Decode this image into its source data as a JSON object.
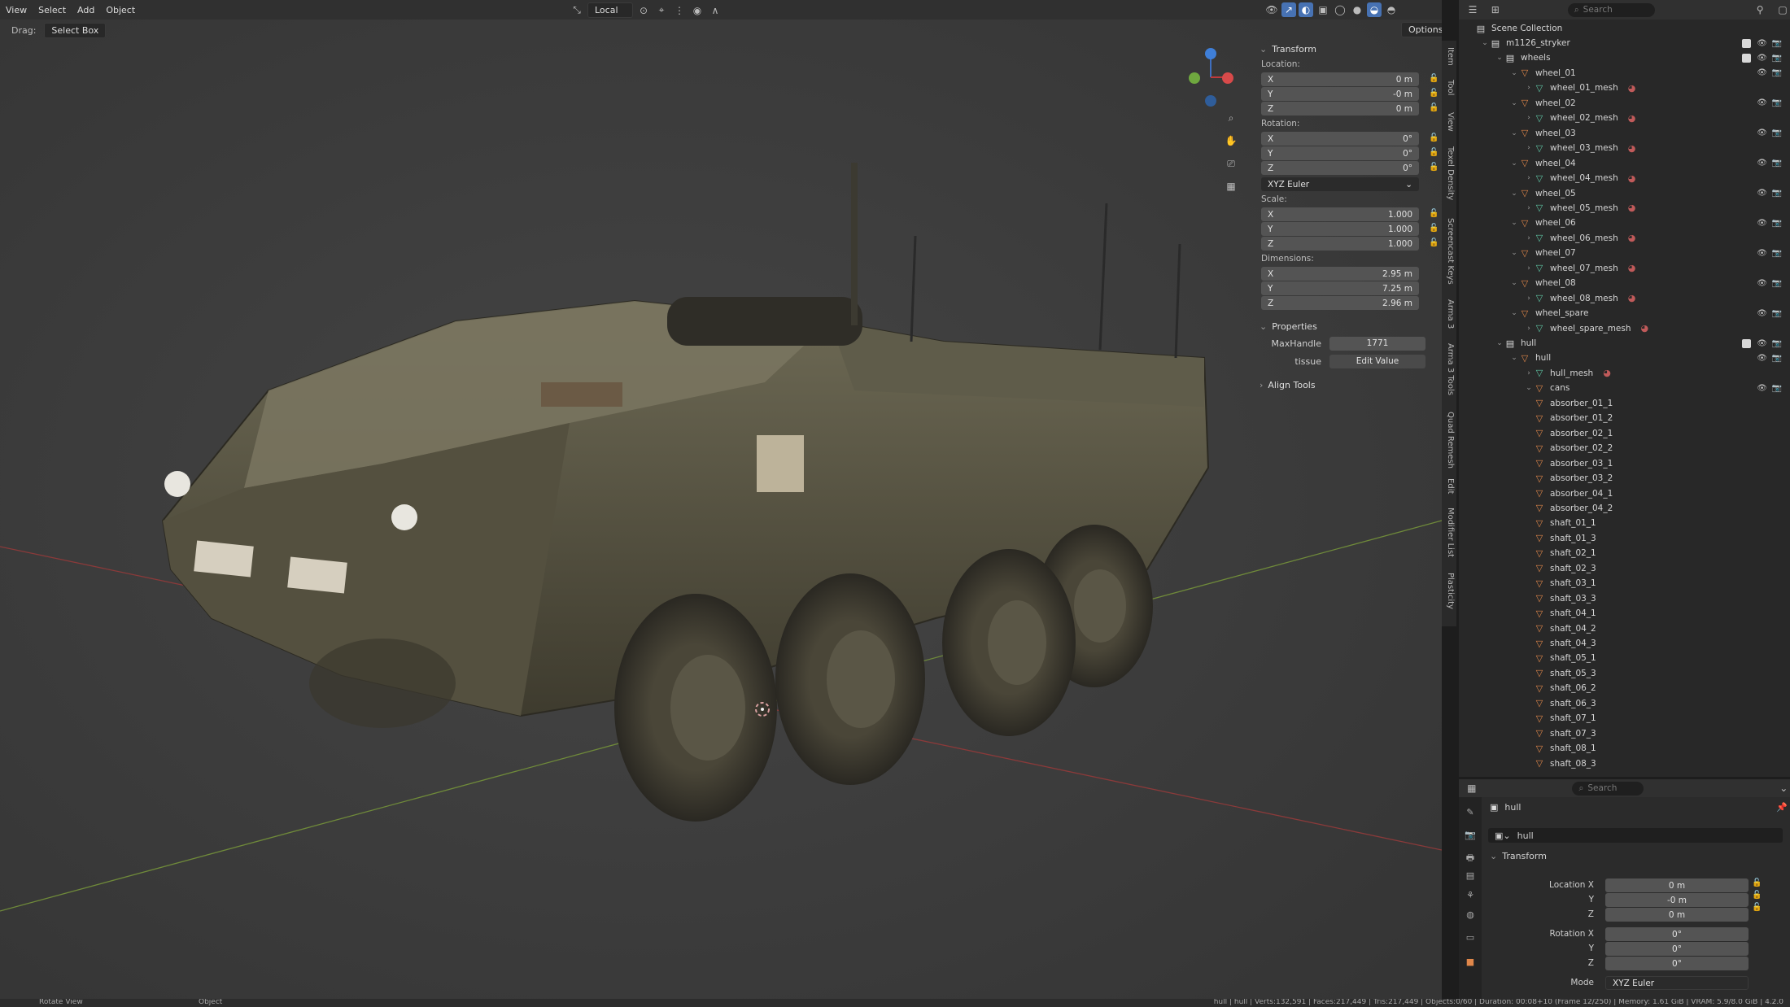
{
  "header": {
    "menus": [
      "View",
      "Select",
      "Add",
      "Object"
    ],
    "orientation": "Local",
    "options": "Options",
    "drag_label": "Drag:",
    "drag_value": "Select Box"
  },
  "npanel": {
    "transform_title": "Transform",
    "location_label": "Location:",
    "location": {
      "x": "0 m",
      "y": "-0 m",
      "z": "0 m"
    },
    "rotation_label": "Rotation:",
    "rotation": {
      "x": "0°",
      "y": "0°",
      "z": "0°"
    },
    "rotation_mode": "XYZ Euler",
    "scale_label": "Scale:",
    "scale": {
      "x": "1.000",
      "y": "1.000",
      "z": "1.000"
    },
    "dimensions_label": "Dimensions:",
    "dimensions": {
      "x": "2.95 m",
      "y": "7.25 m",
      "z": "2.96 m"
    },
    "axis": {
      "x": "X",
      "y": "Y",
      "z": "Z"
    },
    "properties_title": "Properties",
    "maxhandle_label": "MaxHandle",
    "maxhandle_value": "1771",
    "tissue_label": "tissue",
    "tissue_value": "Edit Value",
    "align_title": "Align Tools"
  },
  "side_tabs": [
    "Item",
    "Tool",
    "View",
    "Texel Density",
    "Screencast Keys",
    "Arma 3",
    "Arma 3 Tools",
    "Quad Remesh",
    "Edit",
    "Modifier List",
    "Plasticity"
  ],
  "outliner": {
    "search_placeholder": "Search",
    "scene_collection": "Scene Collection",
    "rows": [
      {
        "label": "m1126_stryker",
        "type": "collection",
        "indent": 1
      },
      {
        "label": "wheels",
        "type": "collection",
        "indent": 2
      },
      {
        "label": "wheel_01",
        "type": "empty",
        "indent": 3
      },
      {
        "label": "wheel_01_mesh",
        "type": "mesh",
        "indent": 4
      },
      {
        "label": "wheel_02",
        "type": "empty",
        "indent": 3
      },
      {
        "label": "wheel_02_mesh",
        "type": "mesh",
        "indent": 4
      },
      {
        "label": "wheel_03",
        "type": "empty",
        "indent": 3
      },
      {
        "label": "wheel_03_mesh",
        "type": "mesh",
        "indent": 4
      },
      {
        "label": "wheel_04",
        "type": "empty",
        "indent": 3
      },
      {
        "label": "wheel_04_mesh",
        "type": "mesh",
        "indent": 4
      },
      {
        "label": "wheel_05",
        "type": "empty",
        "indent": 3
      },
      {
        "label": "wheel_05_mesh",
        "type": "mesh",
        "indent": 4
      },
      {
        "label": "wheel_06",
        "type": "empty",
        "indent": 3
      },
      {
        "label": "wheel_06_mesh",
        "type": "mesh",
        "indent": 4
      },
      {
        "label": "wheel_07",
        "type": "empty",
        "indent": 3
      },
      {
        "label": "wheel_07_mesh",
        "type": "mesh",
        "indent": 4
      },
      {
        "label": "wheel_08",
        "type": "empty",
        "indent": 3
      },
      {
        "label": "wheel_08_mesh",
        "type": "mesh",
        "indent": 4
      },
      {
        "label": "wheel_spare",
        "type": "empty",
        "indent": 3
      },
      {
        "label": "wheel_spare_mesh",
        "type": "mesh",
        "indent": 4
      },
      {
        "label": "hull",
        "type": "collection",
        "indent": 2
      },
      {
        "label": "hull",
        "type": "empty",
        "indent": 3
      },
      {
        "label": "hull_mesh",
        "type": "mesh",
        "indent": 4
      },
      {
        "label": "cans",
        "type": "empty",
        "indent": 4
      },
      {
        "label": "absorber_01_1",
        "type": "empty",
        "indent": 4
      },
      {
        "label": "absorber_01_2",
        "type": "empty",
        "indent": 4
      },
      {
        "label": "absorber_02_1",
        "type": "empty",
        "indent": 4
      },
      {
        "label": "absorber_02_2",
        "type": "empty",
        "indent": 4
      },
      {
        "label": "absorber_03_1",
        "type": "empty",
        "indent": 4
      },
      {
        "label": "absorber_03_2",
        "type": "empty",
        "indent": 4
      },
      {
        "label": "absorber_04_1",
        "type": "empty",
        "indent": 4
      },
      {
        "label": "absorber_04_2",
        "type": "empty",
        "indent": 4
      },
      {
        "label": "shaft_01_1",
        "type": "empty",
        "indent": 4
      },
      {
        "label": "shaft_01_3",
        "type": "empty",
        "indent": 4
      },
      {
        "label": "shaft_02_1",
        "type": "empty",
        "indent": 4
      },
      {
        "label": "shaft_02_3",
        "type": "empty",
        "indent": 4
      },
      {
        "label": "shaft_03_1",
        "type": "empty",
        "indent": 4
      },
      {
        "label": "shaft_03_3",
        "type": "empty",
        "indent": 4
      },
      {
        "label": "shaft_04_1",
        "type": "empty",
        "indent": 4
      },
      {
        "label": "shaft_04_2",
        "type": "empty",
        "indent": 4
      },
      {
        "label": "shaft_04_3",
        "type": "empty",
        "indent": 4
      },
      {
        "label": "shaft_05_1",
        "type": "empty",
        "indent": 4
      },
      {
        "label": "shaft_05_3",
        "type": "empty",
        "indent": 4
      },
      {
        "label": "shaft_06_2",
        "type": "empty",
        "indent": 4
      },
      {
        "label": "shaft_06_3",
        "type": "empty",
        "indent": 4
      },
      {
        "label": "shaft_07_1",
        "type": "empty",
        "indent": 4
      },
      {
        "label": "shaft_07_3",
        "type": "empty",
        "indent": 4
      },
      {
        "label": "shaft_08_1",
        "type": "empty",
        "indent": 4
      },
      {
        "label": "shaft_08_3",
        "type": "empty",
        "indent": 4
      }
    ]
  },
  "properties": {
    "search_placeholder": "Search",
    "object_name": "hull",
    "datablock_name": "hull",
    "transform_title": "Transform",
    "location_x_label": "Location X",
    "location": {
      "x": "0 m",
      "y": "-0 m",
      "z": "0 m"
    },
    "rotation_x_label": "Rotation X",
    "rotation": {
      "x": "0°",
      "y": "0°",
      "z": "0°"
    },
    "y_label": "Y",
    "z_label": "Z",
    "mode_label": "Mode",
    "mode_value": "XYZ Euler"
  },
  "status": {
    "left": "Rotate View",
    "mid": "Object",
    "right": "hull | hull | Verts:132,591 | Faces:217,449 | Tris:217,449 | Objects:0/60 | Duration: 00:08+10 (Frame 12/250) | Memory: 1.61 GiB | VRAM: 5.9/8.0 GiB | 4.2.0"
  },
  "colors": {
    "accent": "#4772b3",
    "empty": "#e0874a",
    "mesh": "#5fc6a4",
    "viewport": "#3d3d3d"
  }
}
